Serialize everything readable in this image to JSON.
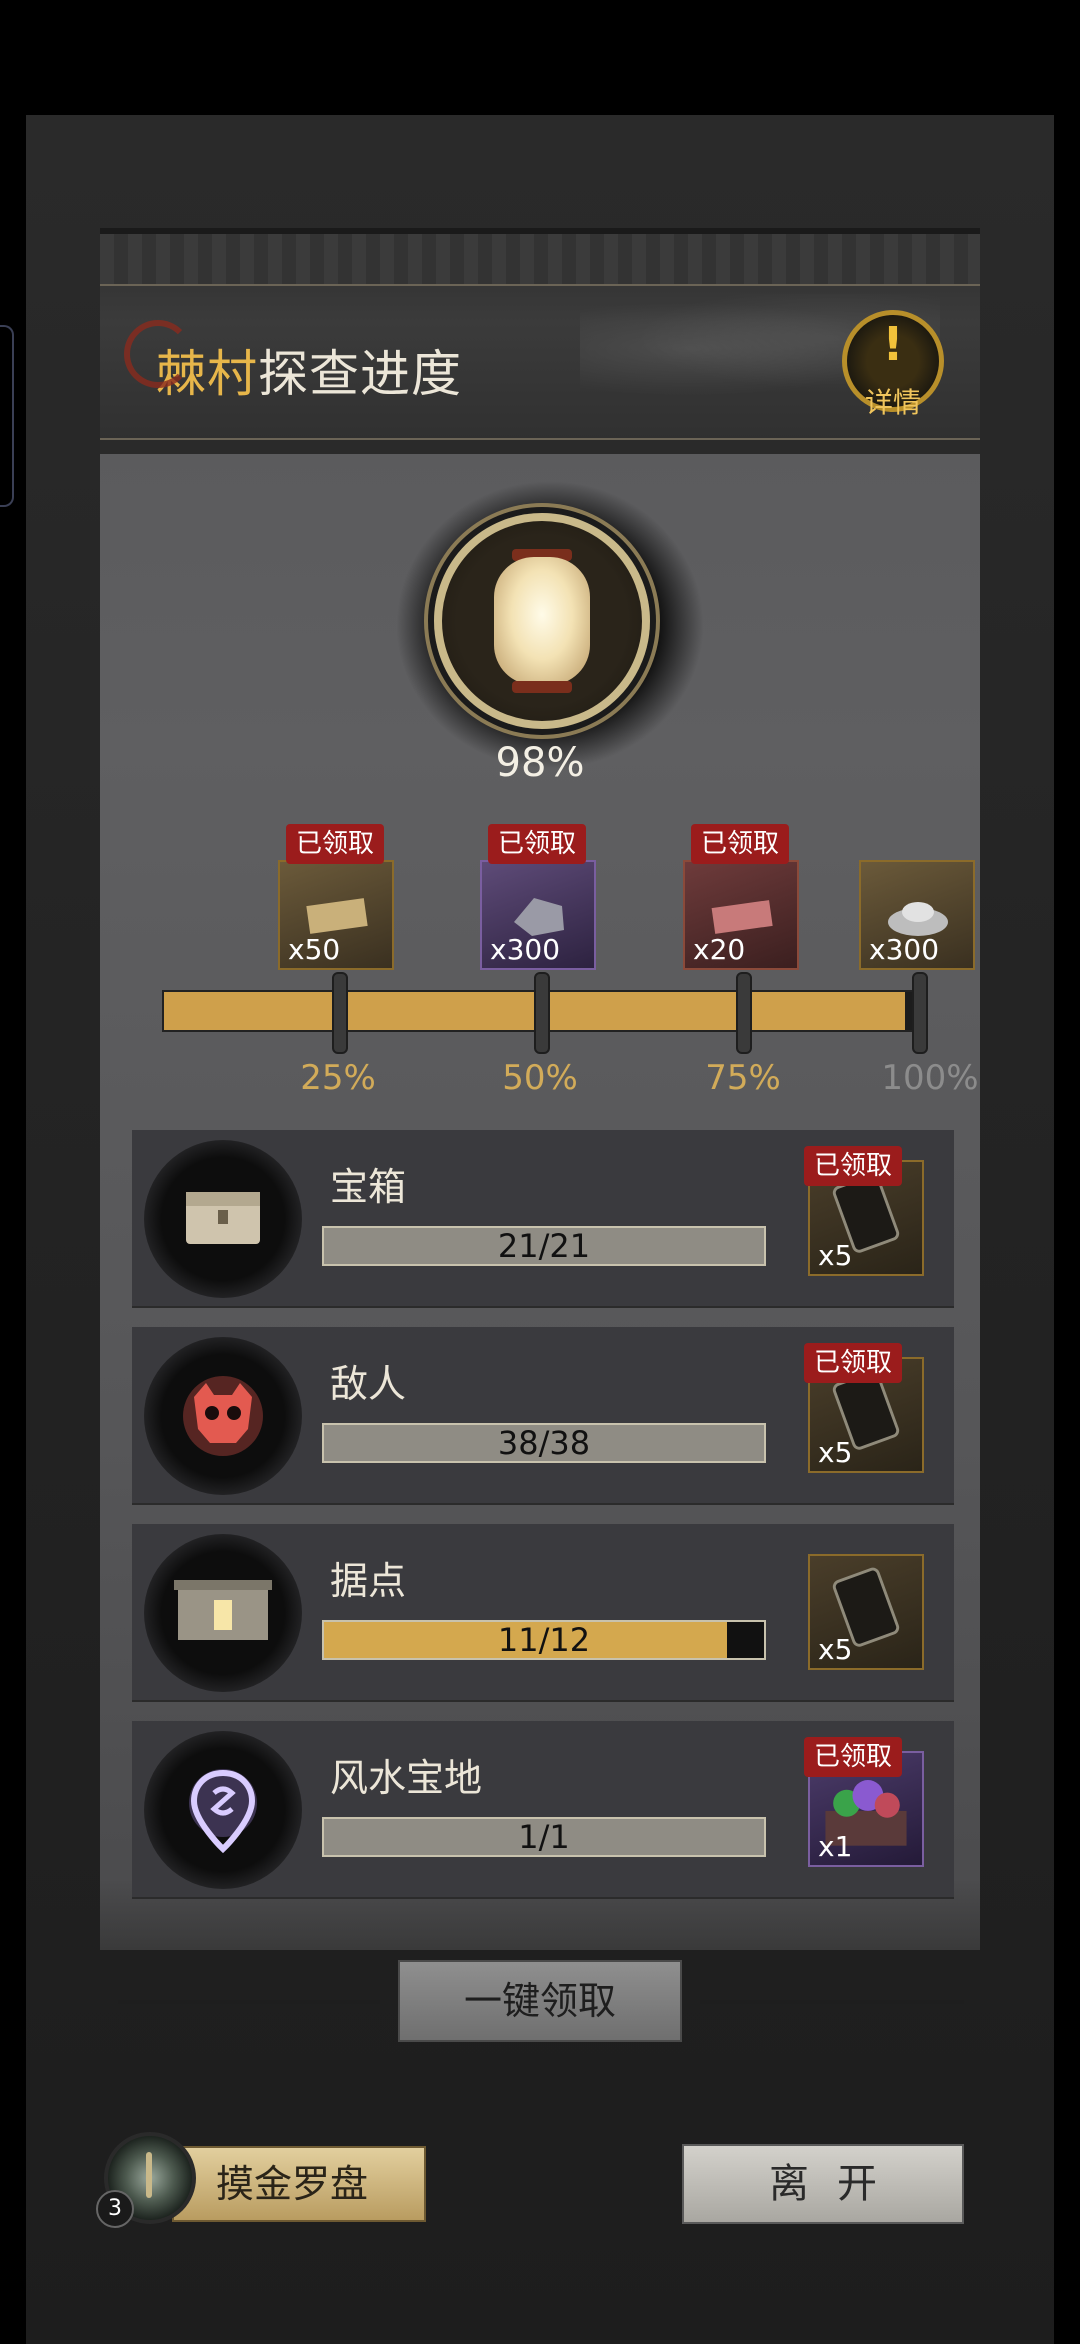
{
  "header": {
    "title_place": "棘村",
    "title_rest": "探查进度",
    "detail_label": "详情",
    "detail_icon": "exclamation-icon",
    "detail_glyph": "!"
  },
  "overall": {
    "percent_text": "98%",
    "percent_value": 98
  },
  "milestones": [
    {
      "label": "25%",
      "qty": "x50",
      "item": "scroll",
      "badge": "已领取",
      "claimed": true
    },
    {
      "label": "50%",
      "qty": "x300",
      "item": "ore",
      "badge": "已领取",
      "claimed": true
    },
    {
      "label": "75%",
      "qty": "x20",
      "item": "red-ingot",
      "badge": "已领取",
      "claimed": true
    },
    {
      "label": "100%",
      "qty": "x300",
      "item": "silver-ingot",
      "badge": "",
      "claimed": false
    }
  ],
  "tasks": [
    {
      "name": "宝箱",
      "progress": "21/21",
      "fraction": 1.0,
      "reward_qty": "x5",
      "badge": "已领取",
      "icon": "treasure-chest-icon"
    },
    {
      "name": "敌人",
      "progress": "38/38",
      "fraction": 1.0,
      "reward_qty": "x5",
      "badge": "已领取",
      "icon": "demon-skull-icon"
    },
    {
      "name": "据点",
      "progress": "11/12",
      "fraction": 0.9167,
      "reward_qty": "x5",
      "badge": "",
      "icon": "stronghold-icon"
    },
    {
      "name": "风水宝地",
      "progress": "1/1",
      "fraction": 1.0,
      "reward_qty": "x1",
      "badge": "已领取",
      "icon": "fengshui-location-icon"
    }
  ],
  "buttons": {
    "claim_all": "一键领取",
    "compass": "摸金罗盘",
    "compass_count": "3",
    "leave": "离开"
  },
  "colors": {
    "gold": "#cfa04b",
    "badge_red": "#9b1c1c",
    "title_gold": "#e7b64a"
  }
}
